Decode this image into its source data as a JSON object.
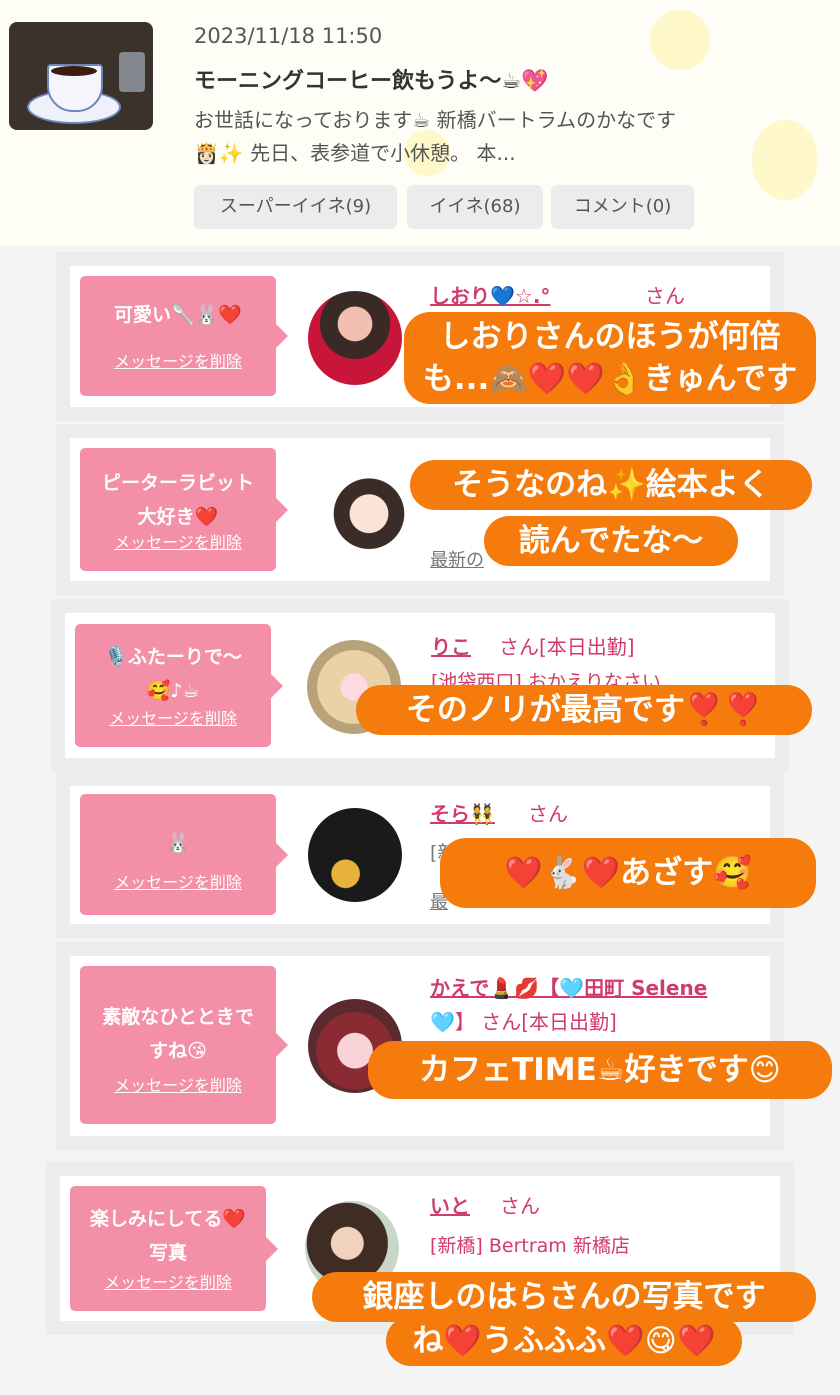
{
  "post": {
    "date": "2023/11/18 11:50",
    "title": "モーニングコーヒー飲もうよ～☕💖",
    "excerpt_line1": "お世話になっております☕ 新橋バートラムのかなです",
    "excerpt_line2": "👸🏻✨ 先日、表参道で小休憩。 本...",
    "super_like": "スーパーイイネ(9)",
    "like": "イイネ(68)",
    "comment": "コメント(0)"
  },
  "delete_label": "メッセージを削除",
  "messages": [
    {
      "text1": "可愛い🥄🐰❤️",
      "text2": "",
      "name": "しおり💙☆.°",
      "san": "さん",
      "line2": "",
      "line3": ""
    },
    {
      "text1": "ピーターラビット",
      "text2": "大好き❤️",
      "name": "",
      "san": "",
      "line2": "",
      "line3": "最新の"
    },
    {
      "text1": "🎙️ふたーりで～",
      "text2": "🥰♪☕",
      "name": "りこ",
      "san": "さん[本日出勤]",
      "line2": "[池袋西口] おかえりなさい",
      "line3": ""
    },
    {
      "text1": "🐰",
      "text2": "",
      "name": "そら👯",
      "san": "さん",
      "line2": "[新",
      "line3": "最"
    },
    {
      "text1": "素敵なひとときで",
      "text2": "すね😘",
      "name": "かえで💄💋【🩵田町 Selene",
      "san": "🩵】 さん[本日出勤]",
      "line2": "",
      "line3": ""
    },
    {
      "text1": "楽しみにしてる❤️",
      "text2": "写真",
      "name": "いと",
      "san": "さん",
      "line2": "[新橋] Bertram 新橋店",
      "line3": ""
    }
  ],
  "overlays": {
    "o1_l1": "しおりさんのほうが何倍",
    "o1_l2": "も...🙈❤️❤️👌きゅんです",
    "o2_l1": "そうなのね✨絵本よく",
    "o2_l2": "読んでたな～",
    "o3": "そのノリが最高です❣️❣️",
    "o4": "❤️🐇❤️あざす🥰",
    "o5": "カフェTIME☕好きです😊",
    "o6_l1": "銀座しのはらさんの写真です",
    "o6_l2": "ね❤️うふふふ❤️😋❤️"
  },
  "colors": {
    "accent_pink": "#f48fa8",
    "name_pink": "#d13b6b",
    "overlay_orange": "#f57c0c"
  }
}
